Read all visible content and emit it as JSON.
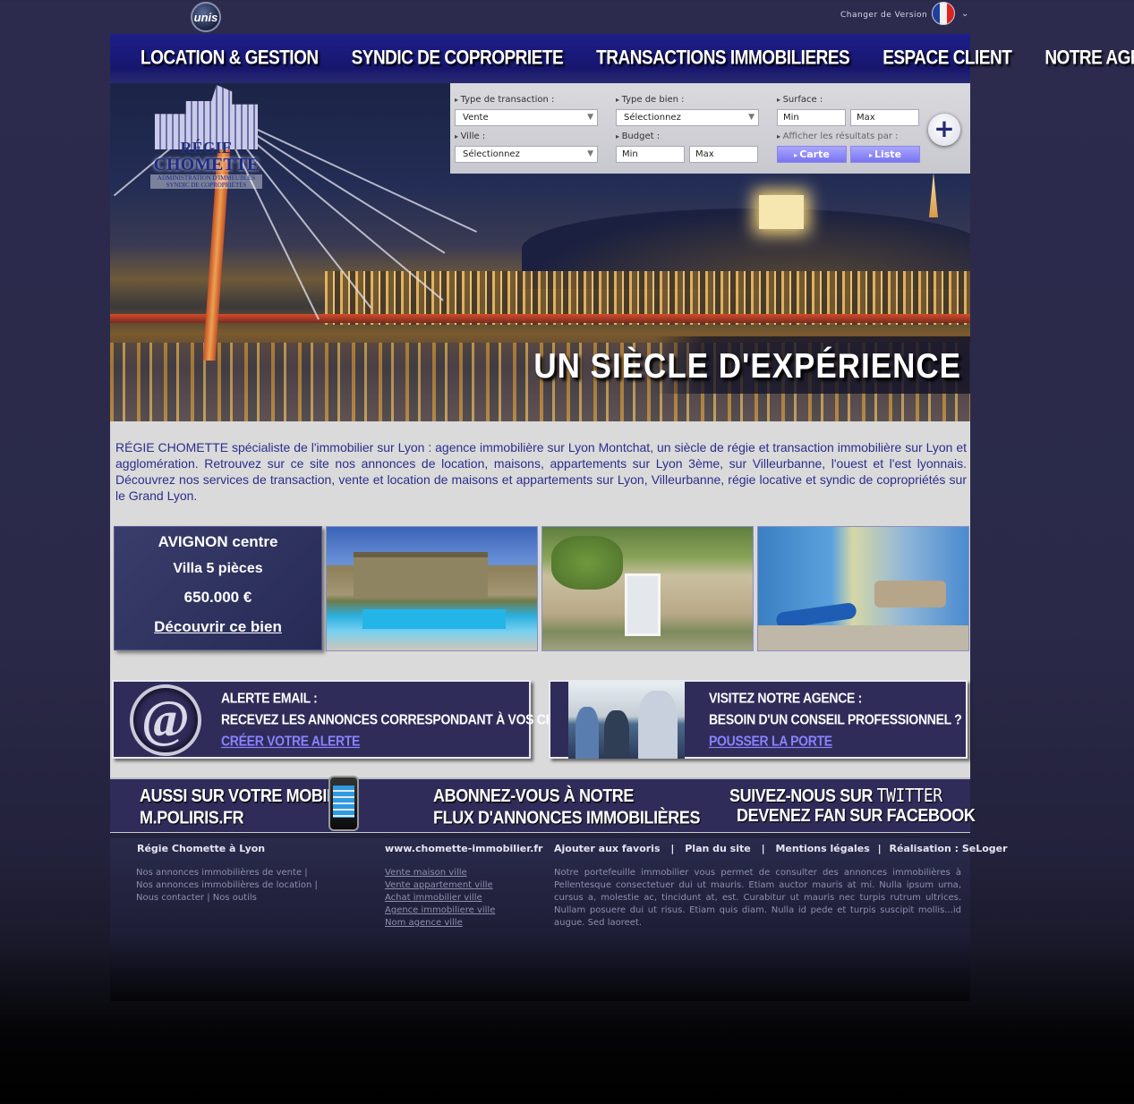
{
  "topbar": {
    "logo_text": "unis",
    "version_label": "Changer de Version"
  },
  "nav": {
    "items": [
      {
        "label": "LOCATION & GESTION"
      },
      {
        "label": "SYNDIC DE COPROPRIETE"
      },
      {
        "label": "TRANSACTIONS IMMOBILIERES"
      },
      {
        "label": "ESPACE CLIENT"
      },
      {
        "label": "NOTRE AGENCE"
      }
    ]
  },
  "logo": {
    "line1": "RÉGIE",
    "line2": "CHOMETTE",
    "line3": "ADMINISTRATION D'IMMEUBLES",
    "line4": "SYNDIC DE COPROPRIÉTÉS"
  },
  "search": {
    "transaction_label": "Type de transaction :",
    "transaction_value": "Vente",
    "property_label": "Type de bien :",
    "property_value": "Sélectionnez",
    "surface_label": "Surface :",
    "surface_min": "Min",
    "surface_max": "Max",
    "city_label": "Ville :",
    "city_value": "Sélectionnez",
    "budget_label": "Budget :",
    "budget_min": "Min",
    "budget_max": "Max",
    "display_label": "Afficher les résultats par :",
    "map_button": "Carte",
    "list_button": "Liste",
    "plus_button": "+"
  },
  "hero": {
    "tagline": "UN SIÈCLE D'EXPÉRIENCE"
  },
  "intro": {
    "text": "RÉGIE CHOMETTE spécialiste de l'immobilier sur Lyon : agence immobilière sur Lyon Montchat, un siècle de régie et transaction immobilière sur Lyon et agglomération. Retrouvez sur ce site nos annonces de location, maisons, appartements sur Lyon 3ème, sur Villeurbanne, l'ouest et l'est lyonnais. Découvrez nos services de transaction, vente et location de maisons et appartements sur Lyon, Villeurbanne, régie locative et syndic de copropriétés sur le Grand Lyon."
  },
  "featured": {
    "city": "AVIGNON centre",
    "type": "Villa 5 pièces",
    "price": "650.000 €",
    "cta": "Découvrir ce bien"
  },
  "promos": {
    "alert": {
      "title": "ALERTE EMAIL :",
      "subtitle": "RECEVEZ LES ANNONCES CORRESPONDANT À VOS CRITÈRES",
      "link": "CRÉER VOTRE ALERTE"
    },
    "agency": {
      "title": "VISITEZ NOTRE AGENCE :",
      "subtitle": "BESOIN D'UN CONSEIL PROFESSIONNEL ?",
      "link": "POUSSER LA PORTE"
    }
  },
  "social": {
    "mobile_line1": "AUSSI SUR VOTRE  MOBILE",
    "mobile_line2": "M.POLIRIS.FR",
    "feed_line1": "ABONNEZ-VOUS À NOTRE",
    "feed_line2": "FLUX D'ANNONCES IMMOBILIÈRES",
    "follow_prefix": "SUIVEZ-NOUS SUR",
    "twitter_word": "TWITTER",
    "facebook_line": "DEVENEZ FAN SUR FACEBOOK"
  },
  "footer": {
    "agency_title": "Régie Chomette à Lyon",
    "site_url": "www.chomette-immobilier.fr",
    "favorites": "Ajouter aux favoris",
    "sitemap": "Plan du site",
    "legal": "Mentions légales",
    "credits": "Réalisation : SeLoger",
    "sep": "|",
    "col1_line1": "Nos annonces immobilières de vente |",
    "col1_line2": "Nos annonces immobilières de location |",
    "col1_line3": "Nous contacter | Nos outils",
    "links": [
      "Vente maison ville",
      "Vente appartement ville",
      "Achat immobilier ville",
      "Agence immobiliere ville",
      "Nom agence ville"
    ],
    "description": "Notre portefeuille immobilier vous permet de consulter des annonces immobilières à Pellentesque consectetuer dui ut mauris. Etiam auctor mauris at mi. Nulla ipsum urna, cursus a, molestie ac, tincidunt at, est. Curabitur ut mauris nec turpis rutrum ultrices. Nullam posuere dui ut risus. Etiam quis diam. Nulla id pede et turpis suscipit mollis...id augue. Sed laoreet."
  }
}
